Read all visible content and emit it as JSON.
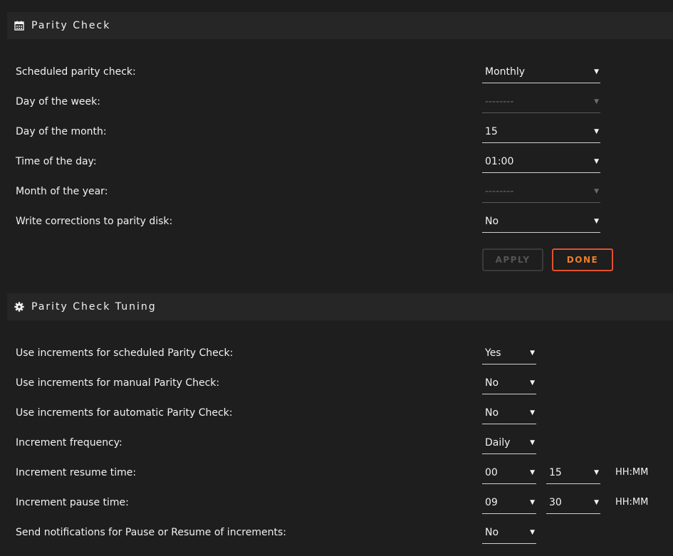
{
  "parity_check": {
    "title": "Parity Check",
    "icon": "calendar-icon",
    "rows": [
      {
        "label": "Scheduled parity check:",
        "value": "Monthly",
        "disabled": false
      },
      {
        "label": "Day of the week:",
        "value": "--------",
        "disabled": true
      },
      {
        "label": "Day of the month:",
        "value": "15",
        "disabled": false
      },
      {
        "label": "Time of the day:",
        "value": "01:00",
        "disabled": false
      },
      {
        "label": "Month of the year:",
        "value": "--------",
        "disabled": true
      },
      {
        "label": "Write corrections to parity disk:",
        "value": "No",
        "disabled": false
      }
    ],
    "apply_label": "APPLY",
    "done_label": "DONE"
  },
  "tuning": {
    "title": "Parity Check Tuning",
    "icon": "gear-icon",
    "rows": [
      {
        "label": "Use increments for scheduled Parity Check:",
        "value": "Yes"
      },
      {
        "label": "Use increments for manual Parity Check:",
        "value": "No"
      },
      {
        "label": "Use increments for automatic Parity Check:",
        "value": "No"
      },
      {
        "label": "Increment frequency:",
        "value": "Daily"
      },
      {
        "label": "Increment resume time:",
        "hours": "00",
        "minutes": "15",
        "unit": "HH:MM"
      },
      {
        "label": "Increment pause time:",
        "hours": "09",
        "minutes": "30",
        "unit": "HH:MM"
      },
      {
        "label": "Send notifications for Pause or Resume of increments:",
        "value": "No"
      }
    ]
  },
  "colors": {
    "background": "#1e1e1e",
    "header_bg": "#262626",
    "accent_orange": "#f07d2a",
    "accent_red": "#e2512f"
  }
}
